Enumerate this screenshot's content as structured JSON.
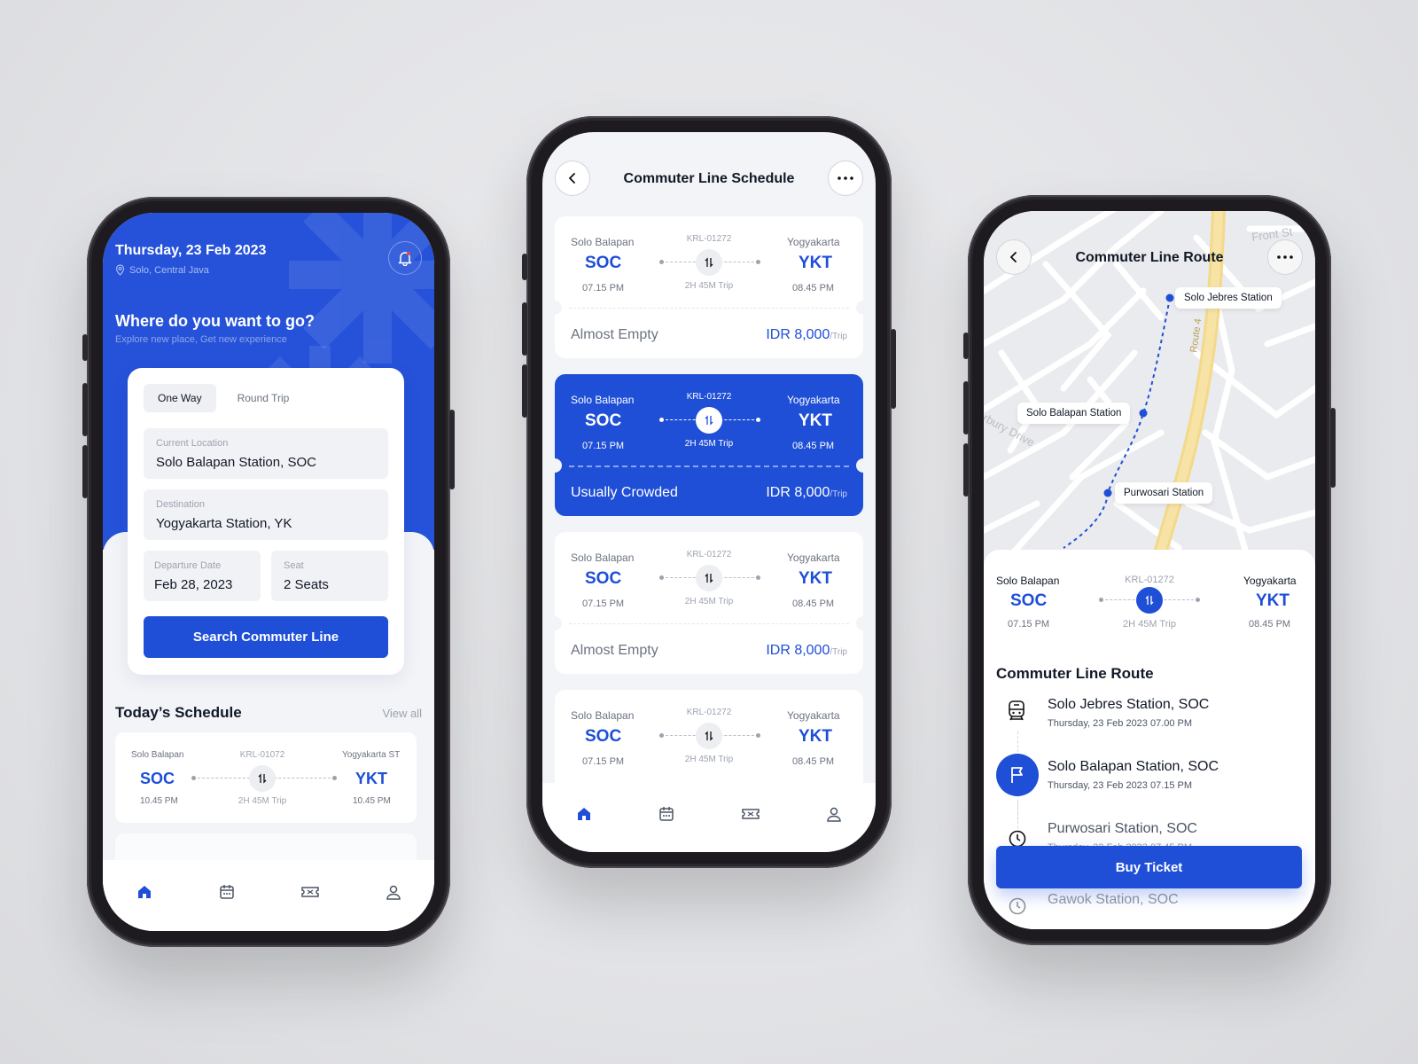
{
  "home": {
    "date": "Thursday, 23 Feb 2023",
    "location": "Solo, Central Java",
    "question": "Where do you want to go?",
    "subtitle": "Explore new place, Get new experience",
    "tabs": [
      "One Way",
      "Round Trip"
    ],
    "current_label": "Current Location",
    "current_value": "Solo Balapan Station, SOC",
    "dest_label": "Destination",
    "dest_value": "Yogyakarta Station, YK",
    "date_label": "Departure Date",
    "date_value": "Feb 28, 2023",
    "seat_label": "Seat",
    "seat_value": "2 Seats",
    "search_button": "Search Commuter Line",
    "schedule_title": "Today’s Schedule",
    "view_all": "View all",
    "mini_trip": {
      "from_station": "Solo Balapan",
      "from_code": "SOC",
      "from_time": "10.45 PM",
      "train": "KRL-01072",
      "duration": "2H 45M Trip",
      "to_station": "Yogyakarta ST",
      "to_code": "YKT",
      "to_time": "10.45 PM"
    }
  },
  "schedule": {
    "title": "Commuter Line Schedule",
    "cards": [
      {
        "from_station": "Solo Balapan",
        "from_code": "SOC",
        "from_time": "07.15 PM",
        "train": "KRL-01272",
        "duration": "2H 45M Trip",
        "to_station": "Yogyakarta",
        "to_code": "YKT",
        "to_time": "08.45 PM",
        "crowd": "Almost Empty",
        "price": "IDR 8,000",
        "unit": "/Trip"
      },
      {
        "from_station": "Solo Balapan",
        "from_code": "SOC",
        "from_time": "07.15 PM",
        "train": "KRL-01272",
        "duration": "2H 45M Trip",
        "to_station": "Yogyakarta",
        "to_code": "YKT",
        "to_time": "08.45 PM",
        "crowd": "Usually Crowded",
        "price": "IDR 8,000",
        "unit": "/Trip"
      },
      {
        "from_station": "Solo Balapan",
        "from_code": "SOC",
        "from_time": "07.15 PM",
        "train": "KRL-01272",
        "duration": "2H 45M Trip",
        "to_station": "Yogyakarta",
        "to_code": "YKT",
        "to_time": "08.45 PM",
        "crowd": "Almost Empty",
        "price": "IDR 8,000",
        "unit": "/Trip"
      },
      {
        "from_station": "Solo Balapan",
        "from_code": "SOC",
        "from_time": "07.15 PM",
        "train": "KRL-01272",
        "duration": "2H 45M Trip",
        "to_station": "Yogyakarta",
        "to_code": "YKT",
        "to_time": "08.45 PM"
      }
    ]
  },
  "route": {
    "title": "Commuter Line Route",
    "map_labels": {
      "front_street": "Front St",
      "route": "Route 4",
      "drive": "rbury Drive"
    },
    "map_pins": [
      "Solo Jebres Station",
      "Solo Balapan Station",
      "Purwosari Station"
    ],
    "trip": {
      "from_station": "Solo Balapan",
      "from_code": "SOC",
      "from_time": "07.15 PM",
      "train": "KRL-01272",
      "duration": "2H 45M Trip",
      "to_station": "Yogyakarta",
      "to_code": "YKT",
      "to_time": "08.45 PM"
    },
    "section_title": "Commuter Line Route",
    "stops": [
      {
        "name": "Solo Jebres Station, SOC",
        "when": "Thursday, 23 Feb 2023    07.00 PM"
      },
      {
        "name": "Solo Balapan Station, SOC",
        "when": "Thursday, 23 Feb 2023    07.15 PM"
      },
      {
        "name": "Purwosari Station, SOC",
        "when": "Thursday, 23 Feb 2023    07.45 PM"
      },
      {
        "name": "Gawok Station, SOC",
        "when": ""
      }
    ],
    "buy_button": "Buy Ticket"
  },
  "colors": {
    "brand": "#1f4fd6",
    "background": "#e4e5e8"
  },
  "icons": [
    "bell-icon",
    "pin-icon",
    "back-icon",
    "more-icon",
    "swap-icon",
    "home-icon",
    "calendar-icon",
    "ticket-icon",
    "profile-icon",
    "train-icon",
    "flag-icon",
    "clock-icon"
  ]
}
